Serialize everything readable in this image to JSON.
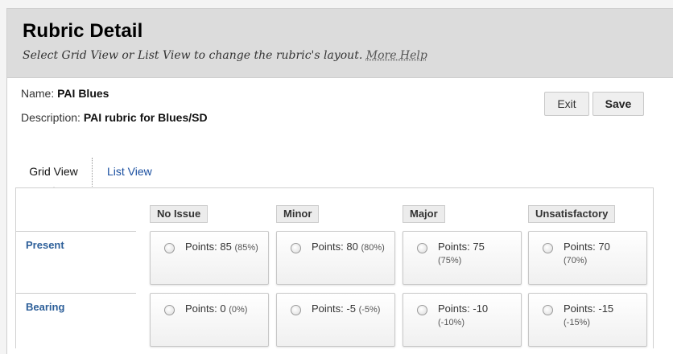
{
  "header": {
    "title": "Rubric Detail",
    "subtitle": "Select Grid View or List View to change the rubric's layout.",
    "help_link": "More Help"
  },
  "info": {
    "name_label": "Name:",
    "name_value": "PAI Blues",
    "description_label": "Description:",
    "description_value": "PAI rubric for Blues/SD"
  },
  "buttons": {
    "exit": "Exit",
    "save": "Save"
  },
  "tabs": {
    "grid": "Grid View",
    "list": "List View",
    "active": "grid"
  },
  "columns": [
    "No Issue",
    "Minor",
    "Major",
    "Unsatisfactory"
  ],
  "rows": [
    {
      "label": "Present",
      "cells": [
        {
          "points_label": "Points:",
          "points": "85",
          "percent": "(85%)"
        },
        {
          "points_label": "Points:",
          "points": "80",
          "percent": "(80%)"
        },
        {
          "points_label": "Points:",
          "points": "75",
          "percent": "(75%)"
        },
        {
          "points_label": "Points:",
          "points": "70",
          "percent": "(70%)"
        }
      ]
    },
    {
      "label": "Bearing",
      "cells": [
        {
          "points_label": "Points:",
          "points": "0",
          "percent": "(0%)"
        },
        {
          "points_label": "Points:",
          "points": "-5",
          "percent": "(-5%)"
        },
        {
          "points_label": "Points:",
          "points": "-10",
          "percent": "(-10%)"
        },
        {
          "points_label": "Points:",
          "points": "-15",
          "percent": "(-15%)"
        }
      ]
    }
  ],
  "colors": {
    "header_bg": "#dcdcdc",
    "link": "#1a4fa0",
    "row_label": "#2d5f99"
  }
}
